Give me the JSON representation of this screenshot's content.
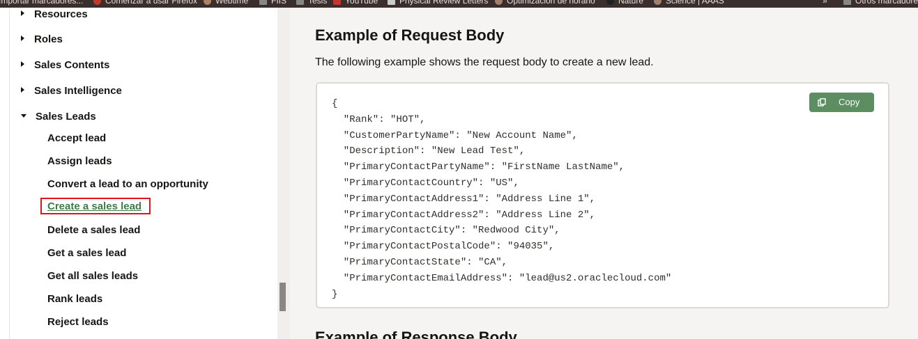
{
  "bookmarks": [
    {
      "label": "Importar marcadores..."
    },
    {
      "label": "Comenzar a usar Firefox"
    },
    {
      "label": "Webtime"
    },
    {
      "label": "FIIS"
    },
    {
      "label": "Tesis"
    },
    {
      "label": "YouTube"
    },
    {
      "label": "Physical Review Letters"
    },
    {
      "label": "Optimización de horario"
    },
    {
      "label": "Nature"
    },
    {
      "label": "Science | AAAS"
    },
    {
      "label": "Otros marcadores"
    }
  ],
  "sidebar": {
    "sections": [
      {
        "label": "Resources",
        "expanded": false
      },
      {
        "label": "Roles",
        "expanded": false
      },
      {
        "label": "Sales Contents",
        "expanded": false
      },
      {
        "label": "Sales Intelligence",
        "expanded": false
      },
      {
        "label": "Sales Leads",
        "expanded": true
      }
    ],
    "items": [
      {
        "label": "Accept lead"
      },
      {
        "label": "Assign leads"
      },
      {
        "label": "Convert a lead to an opportunity"
      },
      {
        "label": "Create a sales lead",
        "active": true
      },
      {
        "label": "Delete a sales lead"
      },
      {
        "label": "Get a sales lead"
      },
      {
        "label": "Get all sales leads"
      },
      {
        "label": "Rank leads"
      },
      {
        "label": "Reject leads"
      }
    ]
  },
  "main": {
    "heading": "Example of Request Body",
    "description": "The following example shows the request body to create a new lead.",
    "code": "{\n  \"Rank\": \"HOT\",\n  \"CustomerPartyName\": \"New Account Name\",\n  \"Description\": \"New Lead Test\",\n  \"PrimaryContactPartyName\": \"FirstName LastName\",\n  \"PrimaryContactCountry\": \"US\",\n  \"PrimaryContactAddress1\": \"Address Line 1\",\n  \"PrimaryContactAddress2\": \"Address Line 2\",\n  \"PrimaryContactCity\": \"Redwood City\",\n  \"PrimaryContactPostalCode\": \"94035\",\n  \"PrimaryContactState\": \"CA\",\n  \"PrimaryContactEmailAddress\": \"lead@us2.oraclecloud.com\"\n}",
    "copy_label": "Copy",
    "next_heading": "Example of Response Body"
  },
  "colors": {
    "accent": "#5c8e61",
    "active_link": "#3f7b4a",
    "highlight": "#e0121a"
  }
}
